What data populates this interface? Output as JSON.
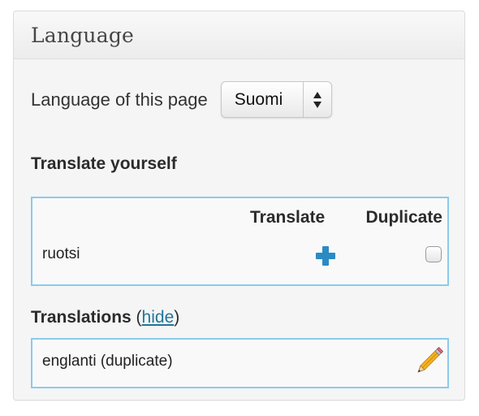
{
  "panel": {
    "title": "Language"
  },
  "language": {
    "label": "Language of this page",
    "selected": "Suomi"
  },
  "translate_yourself": {
    "heading": "Translate yourself",
    "columns": {
      "translate": "Translate",
      "duplicate": "Duplicate"
    },
    "rows": [
      {
        "language": "ruotsi",
        "duplicate_checked": false
      }
    ]
  },
  "translations": {
    "heading": "Translations",
    "open_paren": "(",
    "toggle_link": "hide",
    "close_paren": ")",
    "items": [
      {
        "label": "englanti (duplicate)"
      }
    ]
  },
  "colors": {
    "accent_blue": "#21759b",
    "plus_blue": "#2a8bc4",
    "box_border": "#8ccaea"
  },
  "icons": [
    "chevron-up-down-icon",
    "plus-icon",
    "pencil-icon"
  ]
}
